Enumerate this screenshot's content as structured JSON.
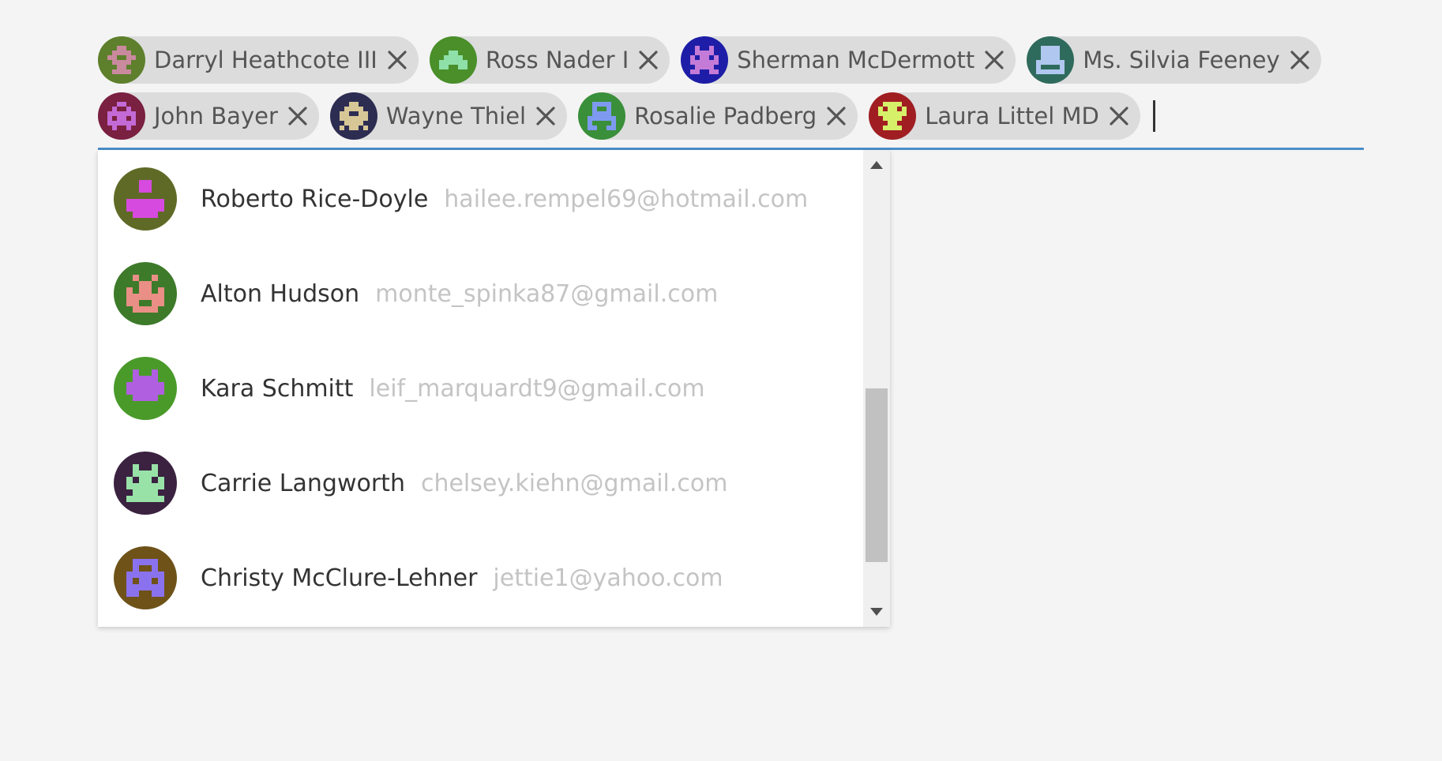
{
  "selected_recipients": [
    {
      "name": "Darryl Heathcote III",
      "avatar": {
        "bg": "#5e7f2c",
        "fg": "#c98a9e",
        "pattern": [
          "001100",
          "011110",
          "110011",
          "011110",
          "001100",
          "011110"
        ]
      }
    },
    {
      "name": "Ross Nader I",
      "avatar": {
        "bg": "#4a8f2a",
        "fg": "#8ee0a8",
        "pattern": [
          "000000",
          "001100",
          "011110",
          "111111",
          "110011",
          "000000"
        ]
      }
    },
    {
      "name": "Sherman McDermott",
      "avatar": {
        "bg": "#1d1da8",
        "fg": "#c47bd8",
        "pattern": [
          "010010",
          "011110",
          "101101",
          "111111",
          "011110",
          "110011"
        ]
      }
    },
    {
      "name": "Ms. Silvia Feeney",
      "avatar": {
        "bg": "#2f6b5c",
        "fg": "#b0c8ef",
        "pattern": [
          "011110",
          "011110",
          "011110",
          "111111",
          "100001",
          "111111"
        ]
      }
    },
    {
      "name": "John Bayer",
      "avatar": {
        "bg": "#7a2040",
        "fg": "#c36ad6",
        "pattern": [
          "001100",
          "010010",
          "111111",
          "101101",
          "111111",
          "010010"
        ]
      }
    },
    {
      "name": "Wayne Thiel",
      "avatar": {
        "bg": "#2d2d52",
        "fg": "#d8c796",
        "pattern": [
          "001100",
          "011110",
          "110011",
          "111111",
          "011110",
          "101101"
        ]
      }
    },
    {
      "name": "Rosalie Padberg",
      "avatar": {
        "bg": "#3a8f3a",
        "fg": "#7e9af0",
        "pattern": [
          "011110",
          "010010",
          "011110",
          "111111",
          "100001",
          "110011"
        ]
      }
    },
    {
      "name": "Laura Littel MD",
      "avatar": {
        "bg": "#a01e22",
        "fg": "#d6f06a",
        "pattern": [
          "011110",
          "101101",
          "111111",
          "011110",
          "001100",
          "011110"
        ]
      }
    }
  ],
  "suggestions": [
    {
      "name": "Roberto Rice-Doyle",
      "email": "hailee.rempel69@hotmail.com",
      "avatar": {
        "bg": "#5f6a26",
        "fg": "#d64adf",
        "pattern": [
          "001100",
          "001100",
          "000000",
          "111111",
          "111111",
          "011110"
        ]
      }
    },
    {
      "name": "Alton Hudson",
      "email": "monte_spinka87@gmail.com",
      "avatar": {
        "bg": "#3d7a2a",
        "fg": "#e98f85",
        "pattern": [
          "010010",
          "001100",
          "101101",
          "111111",
          "110011",
          "011110"
        ]
      }
    },
    {
      "name": "Kara Schmitt",
      "email": "leif_marquardt9@gmail.com",
      "avatar": {
        "bg": "#4a9a2a",
        "fg": "#b05fe0",
        "pattern": [
          "010010",
          "011110",
          "111111",
          "111111",
          "011110",
          "000000"
        ]
      }
    },
    {
      "name": "Carrie Langworth",
      "email": "chelsey.kiehn@gmail.com",
      "avatar": {
        "bg": "#3a2240",
        "fg": "#98e2a8",
        "pattern": [
          "010010",
          "011110",
          "101101",
          "111111",
          "011110",
          "111111"
        ]
      }
    },
    {
      "name": "Christy McClure-Lehner",
      "email": "jettie1@yahoo.com",
      "avatar": {
        "bg": "#6e5218",
        "fg": "#8a72ee",
        "pattern": [
          "011110",
          "010010",
          "111111",
          "101101",
          "111111",
          "110011"
        ]
      }
    }
  ],
  "icons": {
    "remove": "close-icon",
    "scroll_up": "triangle-up-icon",
    "scroll_down": "triangle-down-icon"
  },
  "colors": {
    "accent": "#4a8ec8",
    "chip_bg": "#dcdcdc",
    "email": "#c4c4c4"
  },
  "scroll": {
    "position_fraction": 0.5,
    "visible_fraction": 0.36
  }
}
